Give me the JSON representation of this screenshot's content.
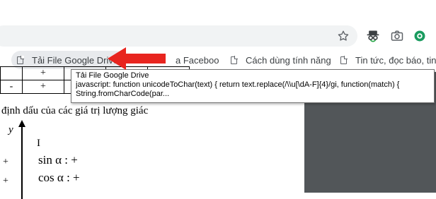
{
  "bookmarks": [
    {
      "label": "Tải File Google Drive",
      "active": true
    },
    {
      "label": "a Faceboo"
    },
    {
      "label": "Cách dùng tính năng"
    },
    {
      "label": "Tin tức, đọc báo, tin m"
    }
  ],
  "tooltip": {
    "title": "Tải File Google Drive",
    "url_line1": "javascript: function unicodeToChar(text) { return text.replace(/\\\\u[\\dA-F]{4}/gi, function(match) {",
    "url_line2": "String.fromCharCode(par..."
  },
  "document": {
    "table_row1": [
      "+",
      "+"
    ],
    "table_row2": [
      "-",
      "+"
    ],
    "heading": "định dấu của các giá trị lượng giác",
    "axis_label": "y",
    "quadrant": "I",
    "sin_line": "sin α : +",
    "cos_line": "cos α : +",
    "left_plus": "+",
    "left_plus2": "+"
  },
  "icons": [
    "star-icon",
    "incognito-icon",
    "camera-icon",
    "extension-icon"
  ],
  "colors": {
    "arrow": "#e8251f",
    "pdf_background": "#525659"
  }
}
